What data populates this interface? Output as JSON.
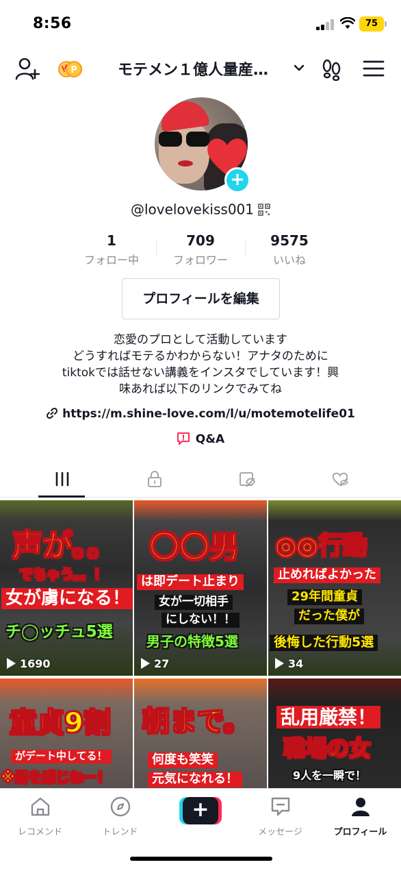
{
  "status_bar": {
    "time": "8:56",
    "battery": "75"
  },
  "header": {
    "title": "モテメン１億人量産…",
    "icons": [
      "add-user-icon",
      "coin-icon",
      "chevron-down-icon",
      "footprint-icon",
      "menu-icon"
    ]
  },
  "profile": {
    "username": "@lovelovekiss001",
    "stats": [
      {
        "value": "1",
        "label": "フォロー中"
      },
      {
        "value": "709",
        "label": "フォロワー"
      },
      {
        "value": "9575",
        "label": "いいね"
      }
    ],
    "edit_button": "プロフィールを編集",
    "bio_lines": [
      "恋愛のプロとして活動しています",
      "どうすればモテるかわからない！アナタのために",
      "tiktokでは話せない講義をインスタでしています！興",
      "味あれば以下のリンクでみてね"
    ],
    "link": "https://m.shine-love.com/l/u/motemotelife01",
    "qa_label": "Q&A"
  },
  "tabs": [
    "videos-tab",
    "private-tab",
    "reposts-tab",
    "liked-tab"
  ],
  "videos": [
    {
      "views": "1690",
      "lines": [
        "声が。。",
        "でちゃう。。！",
        "女が虜になる！",
        "チ◯ッチュ5選"
      ]
    },
    {
      "views": "27",
      "lines": [
        "〇〇男",
        "は即デート止まり",
        "女が一切相手",
        "にしない！！",
        "男子の特徴5選"
      ]
    },
    {
      "views": "34",
      "lines": [
        "◎◎行動",
        "止めればよかった",
        "29年間童貞",
        "だった僕が",
        "後悔した行動5選"
      ]
    },
    {
      "views": "",
      "lines": [
        "童貞9割",
        "がデート中してる！",
        "※男を感じねー！"
      ]
    },
    {
      "views": "",
      "lines": [
        "朝まで。",
        "何度も笑笑",
        "元気になれる！"
      ]
    },
    {
      "views": "",
      "lines": [
        "乱用厳禁！",
        "職場の女",
        "9人を一瞬で！"
      ]
    }
  ],
  "bottom_nav": [
    {
      "label": "レコメンド"
    },
    {
      "label": "トレンド"
    },
    {
      "label": "+"
    },
    {
      "label": "メッセージ"
    },
    {
      "label": "プロフィール"
    }
  ]
}
